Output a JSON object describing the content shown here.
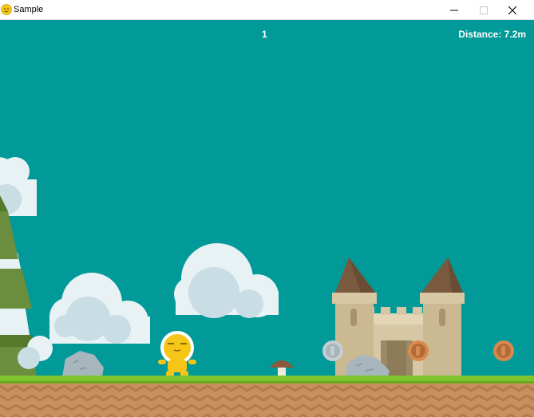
{
  "window": {
    "title": "Sample",
    "icon": "smiley-face-icon",
    "controls": [
      "minimize-icon",
      "maximize-icon",
      "close-icon"
    ]
  },
  "hud": {
    "score": "1",
    "distance": "Distance: 7.2m"
  },
  "colors": {
    "sky": "#019a98",
    "grass": "#7dc42d",
    "dirt": "#c28d5f",
    "player": "#f5c518",
    "cloud": "#e8f1f4"
  },
  "scene": {
    "player": "yellow-bubble-character",
    "coins": [
      "silver-coin-icon",
      "bronze-coin-icon",
      "bronze-coin-icon"
    ],
    "objects": [
      "pine-tree",
      "cloud",
      "cloud",
      "cloud",
      "rock",
      "rock",
      "mushroom",
      "castle"
    ]
  }
}
